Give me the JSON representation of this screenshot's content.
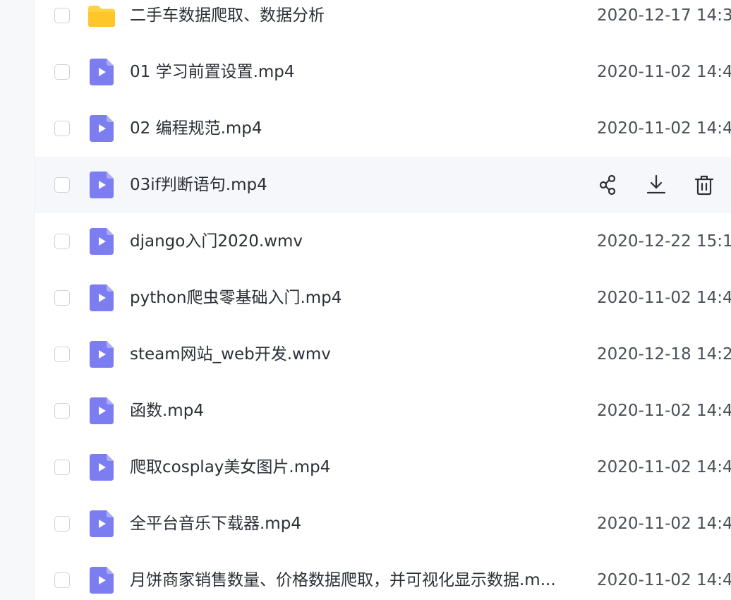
{
  "files": [
    {
      "type": "folder",
      "name": "二手车数据爬取、数据分析",
      "date": "2020-12-17 14:3"
    },
    {
      "type": "video",
      "name": "01 学习前置设置.mp4",
      "date": "2020-11-02 14:4"
    },
    {
      "type": "video",
      "name": "02 编程规范.mp4",
      "date": "2020-11-02 14:4"
    },
    {
      "type": "video",
      "name": "03if判断语句.mp4",
      "date": "",
      "hovered": true
    },
    {
      "type": "video",
      "name": "django入门2020.wmv",
      "date": "2020-12-22 15:1"
    },
    {
      "type": "video",
      "name": "python爬虫零基础入门.mp4",
      "date": "2020-11-02 14:4"
    },
    {
      "type": "video",
      "name": "steam网站_web开发.wmv",
      "date": "2020-12-18 14:2"
    },
    {
      "type": "video",
      "name": "函数.mp4",
      "date": "2020-11-02 14:4"
    },
    {
      "type": "video",
      "name": "爬取cosplay美女图片.mp4",
      "date": "2020-11-02 14:4"
    },
    {
      "type": "video",
      "name": "全平台音乐下载器.mp4",
      "date": "2020-11-02 14:4"
    },
    {
      "type": "video",
      "name": "月饼商家销售数量、价格数据爬取，并可视化显示数据.m...",
      "date": "2020-11-02 14:4"
    }
  ],
  "row_actions": [
    "share-icon",
    "download-icon",
    "delete-icon"
  ],
  "colors": {
    "folder": "#FFD23F",
    "video_file": "#7D7DF2",
    "hover_row": "#F6F7FB",
    "text": "#2B2F36"
  }
}
